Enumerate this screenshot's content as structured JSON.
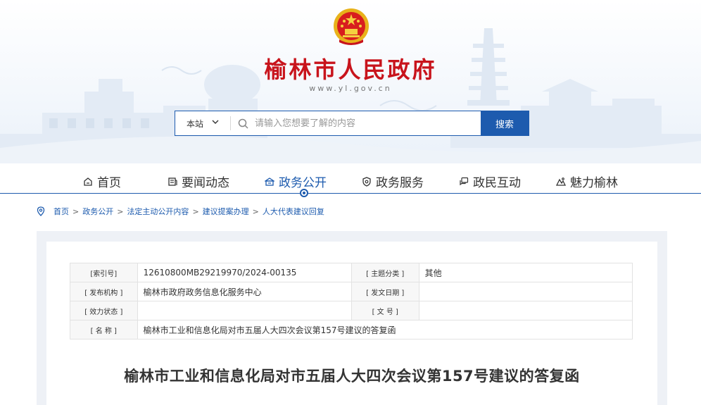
{
  "header": {
    "site_title": "榆林市人民政府",
    "site_domain": "www.yl.gov.cn",
    "emblem_icon": "national-emblem",
    "title_color": "#c8141c"
  },
  "search": {
    "scope_label": "本站",
    "placeholder": "请输入您想要了解的内容",
    "button_label": "搜索",
    "accent_color": "#1d5bae"
  },
  "nav": {
    "items": [
      {
        "label": "首页",
        "icon": "home-icon"
      },
      {
        "label": "要闻动态",
        "icon": "news-icon"
      },
      {
        "label": "政务公开",
        "icon": "government-icon",
        "active": true
      },
      {
        "label": "政务服务",
        "icon": "service-icon"
      },
      {
        "label": "政民互动",
        "icon": "chat-icon"
      },
      {
        "label": "魅力榆林",
        "icon": "scenery-icon"
      }
    ]
  },
  "breadcrumb": {
    "items": [
      "首页",
      "政务公开",
      "法定主动公开内容",
      "建议提案办理",
      "人大代表建议回复"
    ],
    "separator": ">"
  },
  "meta": {
    "index_label": "[索引号]",
    "index_value": "12610800MB29219970/2024-00135",
    "category_label": "[ 主题分类 ]",
    "category_value": "其他",
    "publisher_label": "[ 发布机构 ]",
    "publisher_value": "榆林市政府政务信息化服务中心",
    "date_label": "[ 发文日期 ]",
    "date_value": "",
    "status_label": "[ 效力状态 ]",
    "status_value": "",
    "docno_label": "[ 文 号 ]",
    "docno_value": "",
    "name_label": "[ 名 称 ]",
    "name_value": "榆林市工业和信息化局对市五届人大四次会议第157号建议的答复函"
  },
  "document": {
    "title": "榆林市工业和信息化局对市五届人大四次会议第157号建议的答复函"
  }
}
